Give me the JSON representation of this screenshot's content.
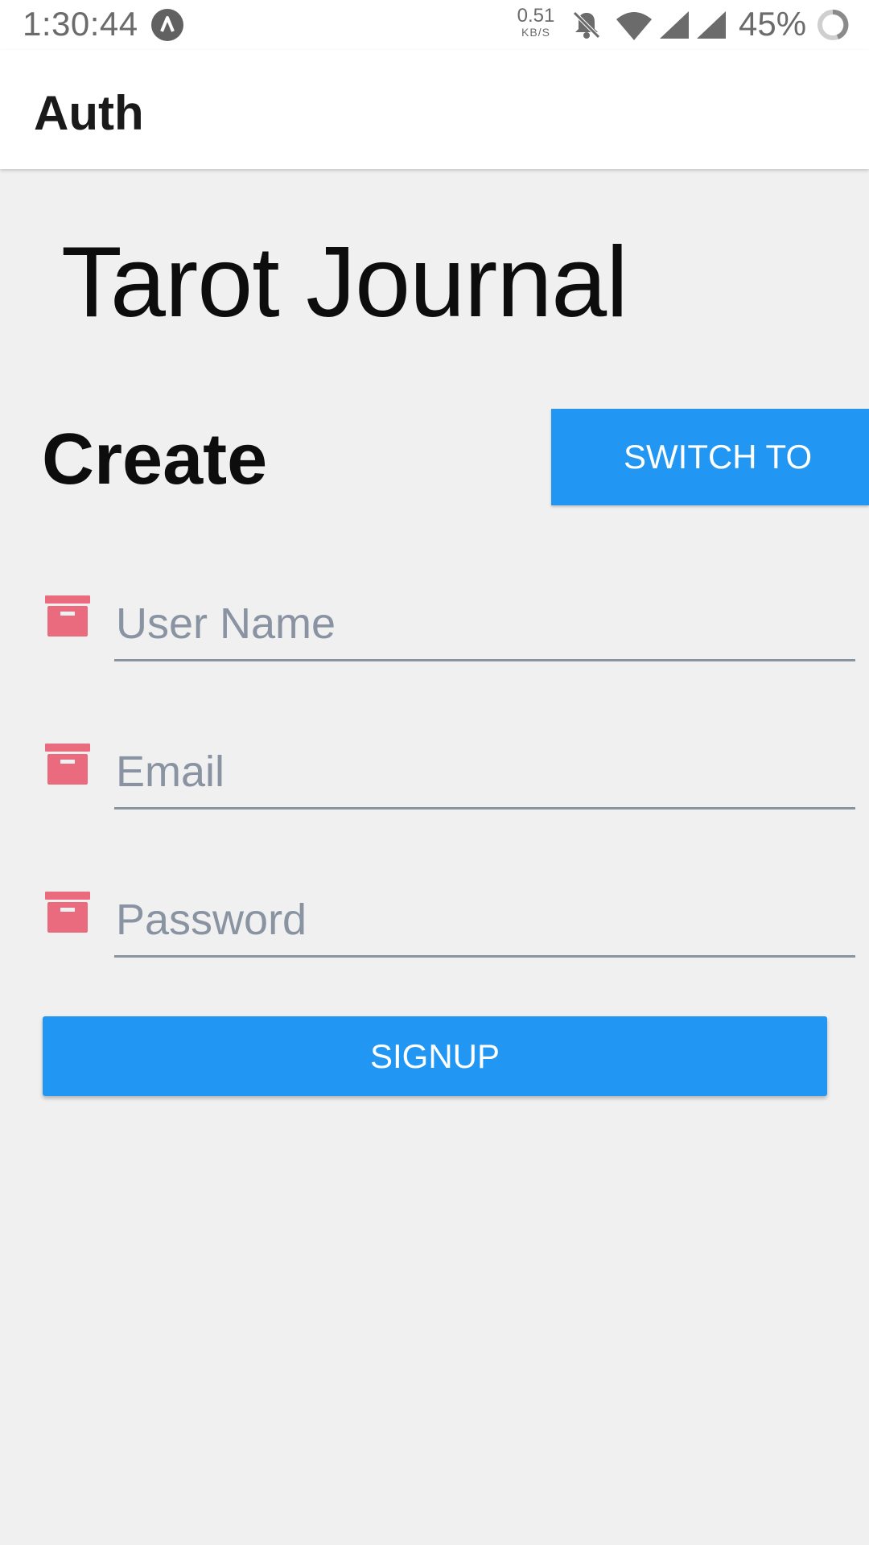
{
  "status_bar": {
    "time": "1:30:44",
    "net_speed_value": "0.51",
    "net_speed_unit": "KB/S",
    "battery_percent": "45%"
  },
  "app_bar": {
    "title": "Auth"
  },
  "main": {
    "app_title": "Tarot Journal",
    "heading": "Create",
    "switch_button_label": "SWITCH TO",
    "fields": [
      {
        "placeholder": "User Name",
        "icon": "archive-icon"
      },
      {
        "placeholder": "Email",
        "icon": "archive-icon"
      },
      {
        "placeholder": "Password",
        "icon": "archive-icon"
      }
    ],
    "signup_button_label": "SIGNUP"
  },
  "colors": {
    "primary": "#2196f3",
    "icon": "#ea6a7e",
    "background": "#f0f0f0",
    "underline": "#8a93a0",
    "placeholder": "#8993a2"
  }
}
